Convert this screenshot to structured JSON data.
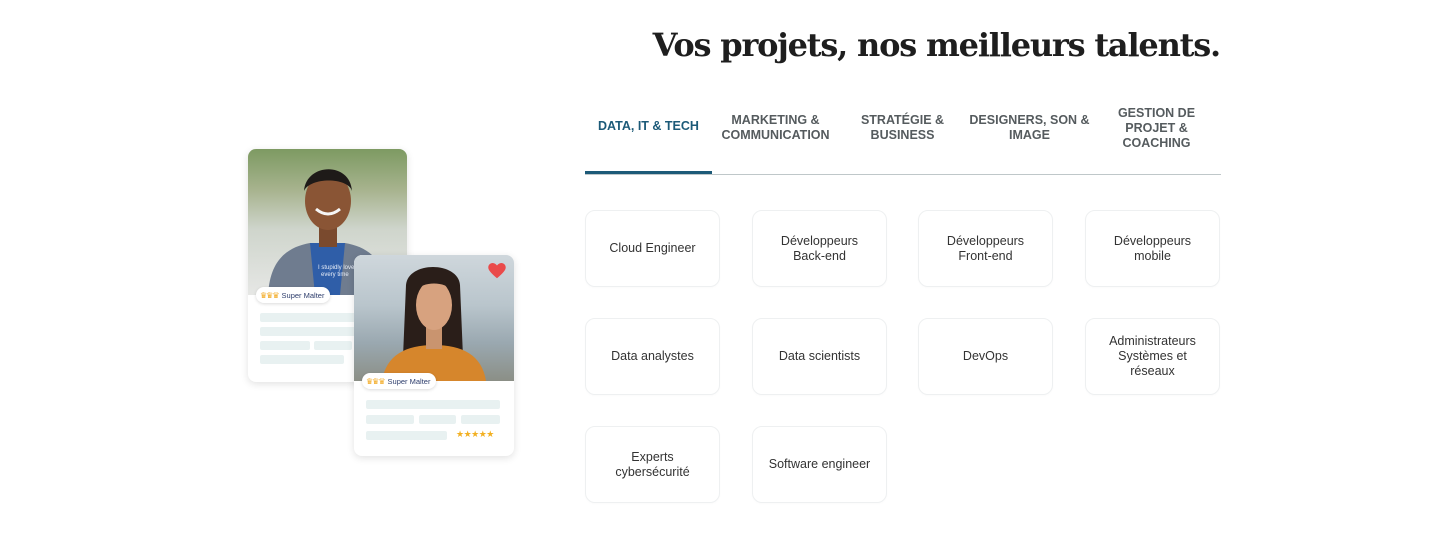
{
  "heading": "Vos projets, nos meilleurs talents.",
  "tabs": [
    {
      "label": "DATA, IT & TECH",
      "active": true
    },
    {
      "label": "MARKETING & COMMUNICATION",
      "active": false
    },
    {
      "label": "STRATÉGIE & BUSINESS",
      "active": false
    },
    {
      "label": "DESIGNERS, SON & IMAGE",
      "active": false
    },
    {
      "label": "GESTION DE PROJET & COACHING",
      "active": false
    }
  ],
  "categories": [
    "Cloud Engineer",
    "Développeurs Back-end",
    "Développeurs Front-end",
    "Développeurs mobile",
    "Data analystes",
    "Data scientists",
    "DevOps",
    "Administrateurs Systèmes et réseaux",
    "Experts cybersécurité",
    "Software engineer"
  ],
  "illustration": {
    "badge_label": "Super Malter",
    "shirt_text": "I stupidly love every time",
    "heart_icon": "heart-icon",
    "rating_stars": "★★★★★",
    "colors": {
      "accent": "#1c5a78",
      "heart": "#ea4a4a",
      "stars": "#f2b022",
      "badge_text": "#2d3d6c"
    }
  }
}
